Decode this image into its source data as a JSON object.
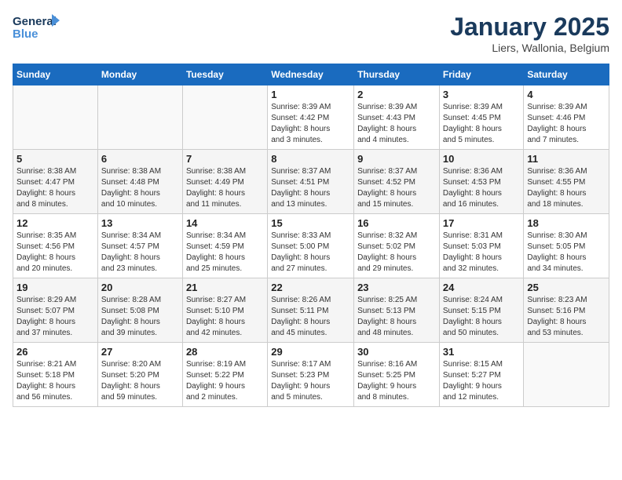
{
  "logo": {
    "line1": "General",
    "line2": "Blue"
  },
  "title": "January 2025",
  "subtitle": "Liers, Wallonia, Belgium",
  "weekdays": [
    "Sunday",
    "Monday",
    "Tuesday",
    "Wednesday",
    "Thursday",
    "Friday",
    "Saturday"
  ],
  "weeks": [
    [
      {
        "day": "",
        "info": ""
      },
      {
        "day": "",
        "info": ""
      },
      {
        "day": "",
        "info": ""
      },
      {
        "day": "1",
        "info": "Sunrise: 8:39 AM\nSunset: 4:42 PM\nDaylight: 8 hours\nand 3 minutes."
      },
      {
        "day": "2",
        "info": "Sunrise: 8:39 AM\nSunset: 4:43 PM\nDaylight: 8 hours\nand 4 minutes."
      },
      {
        "day": "3",
        "info": "Sunrise: 8:39 AM\nSunset: 4:45 PM\nDaylight: 8 hours\nand 5 minutes."
      },
      {
        "day": "4",
        "info": "Sunrise: 8:39 AM\nSunset: 4:46 PM\nDaylight: 8 hours\nand 7 minutes."
      }
    ],
    [
      {
        "day": "5",
        "info": "Sunrise: 8:38 AM\nSunset: 4:47 PM\nDaylight: 8 hours\nand 8 minutes."
      },
      {
        "day": "6",
        "info": "Sunrise: 8:38 AM\nSunset: 4:48 PM\nDaylight: 8 hours\nand 10 minutes."
      },
      {
        "day": "7",
        "info": "Sunrise: 8:38 AM\nSunset: 4:49 PM\nDaylight: 8 hours\nand 11 minutes."
      },
      {
        "day": "8",
        "info": "Sunrise: 8:37 AM\nSunset: 4:51 PM\nDaylight: 8 hours\nand 13 minutes."
      },
      {
        "day": "9",
        "info": "Sunrise: 8:37 AM\nSunset: 4:52 PM\nDaylight: 8 hours\nand 15 minutes."
      },
      {
        "day": "10",
        "info": "Sunrise: 8:36 AM\nSunset: 4:53 PM\nDaylight: 8 hours\nand 16 minutes."
      },
      {
        "day": "11",
        "info": "Sunrise: 8:36 AM\nSunset: 4:55 PM\nDaylight: 8 hours\nand 18 minutes."
      }
    ],
    [
      {
        "day": "12",
        "info": "Sunrise: 8:35 AM\nSunset: 4:56 PM\nDaylight: 8 hours\nand 20 minutes."
      },
      {
        "day": "13",
        "info": "Sunrise: 8:34 AM\nSunset: 4:57 PM\nDaylight: 8 hours\nand 23 minutes."
      },
      {
        "day": "14",
        "info": "Sunrise: 8:34 AM\nSunset: 4:59 PM\nDaylight: 8 hours\nand 25 minutes."
      },
      {
        "day": "15",
        "info": "Sunrise: 8:33 AM\nSunset: 5:00 PM\nDaylight: 8 hours\nand 27 minutes."
      },
      {
        "day": "16",
        "info": "Sunrise: 8:32 AM\nSunset: 5:02 PM\nDaylight: 8 hours\nand 29 minutes."
      },
      {
        "day": "17",
        "info": "Sunrise: 8:31 AM\nSunset: 5:03 PM\nDaylight: 8 hours\nand 32 minutes."
      },
      {
        "day": "18",
        "info": "Sunrise: 8:30 AM\nSunset: 5:05 PM\nDaylight: 8 hours\nand 34 minutes."
      }
    ],
    [
      {
        "day": "19",
        "info": "Sunrise: 8:29 AM\nSunset: 5:07 PM\nDaylight: 8 hours\nand 37 minutes."
      },
      {
        "day": "20",
        "info": "Sunrise: 8:28 AM\nSunset: 5:08 PM\nDaylight: 8 hours\nand 39 minutes."
      },
      {
        "day": "21",
        "info": "Sunrise: 8:27 AM\nSunset: 5:10 PM\nDaylight: 8 hours\nand 42 minutes."
      },
      {
        "day": "22",
        "info": "Sunrise: 8:26 AM\nSunset: 5:11 PM\nDaylight: 8 hours\nand 45 minutes."
      },
      {
        "day": "23",
        "info": "Sunrise: 8:25 AM\nSunset: 5:13 PM\nDaylight: 8 hours\nand 48 minutes."
      },
      {
        "day": "24",
        "info": "Sunrise: 8:24 AM\nSunset: 5:15 PM\nDaylight: 8 hours\nand 50 minutes."
      },
      {
        "day": "25",
        "info": "Sunrise: 8:23 AM\nSunset: 5:16 PM\nDaylight: 8 hours\nand 53 minutes."
      }
    ],
    [
      {
        "day": "26",
        "info": "Sunrise: 8:21 AM\nSunset: 5:18 PM\nDaylight: 8 hours\nand 56 minutes."
      },
      {
        "day": "27",
        "info": "Sunrise: 8:20 AM\nSunset: 5:20 PM\nDaylight: 8 hours\nand 59 minutes."
      },
      {
        "day": "28",
        "info": "Sunrise: 8:19 AM\nSunset: 5:22 PM\nDaylight: 9 hours\nand 2 minutes."
      },
      {
        "day": "29",
        "info": "Sunrise: 8:17 AM\nSunset: 5:23 PM\nDaylight: 9 hours\nand 5 minutes."
      },
      {
        "day": "30",
        "info": "Sunrise: 8:16 AM\nSunset: 5:25 PM\nDaylight: 9 hours\nand 8 minutes."
      },
      {
        "day": "31",
        "info": "Sunrise: 8:15 AM\nSunset: 5:27 PM\nDaylight: 9 hours\nand 12 minutes."
      },
      {
        "day": "",
        "info": ""
      }
    ]
  ]
}
